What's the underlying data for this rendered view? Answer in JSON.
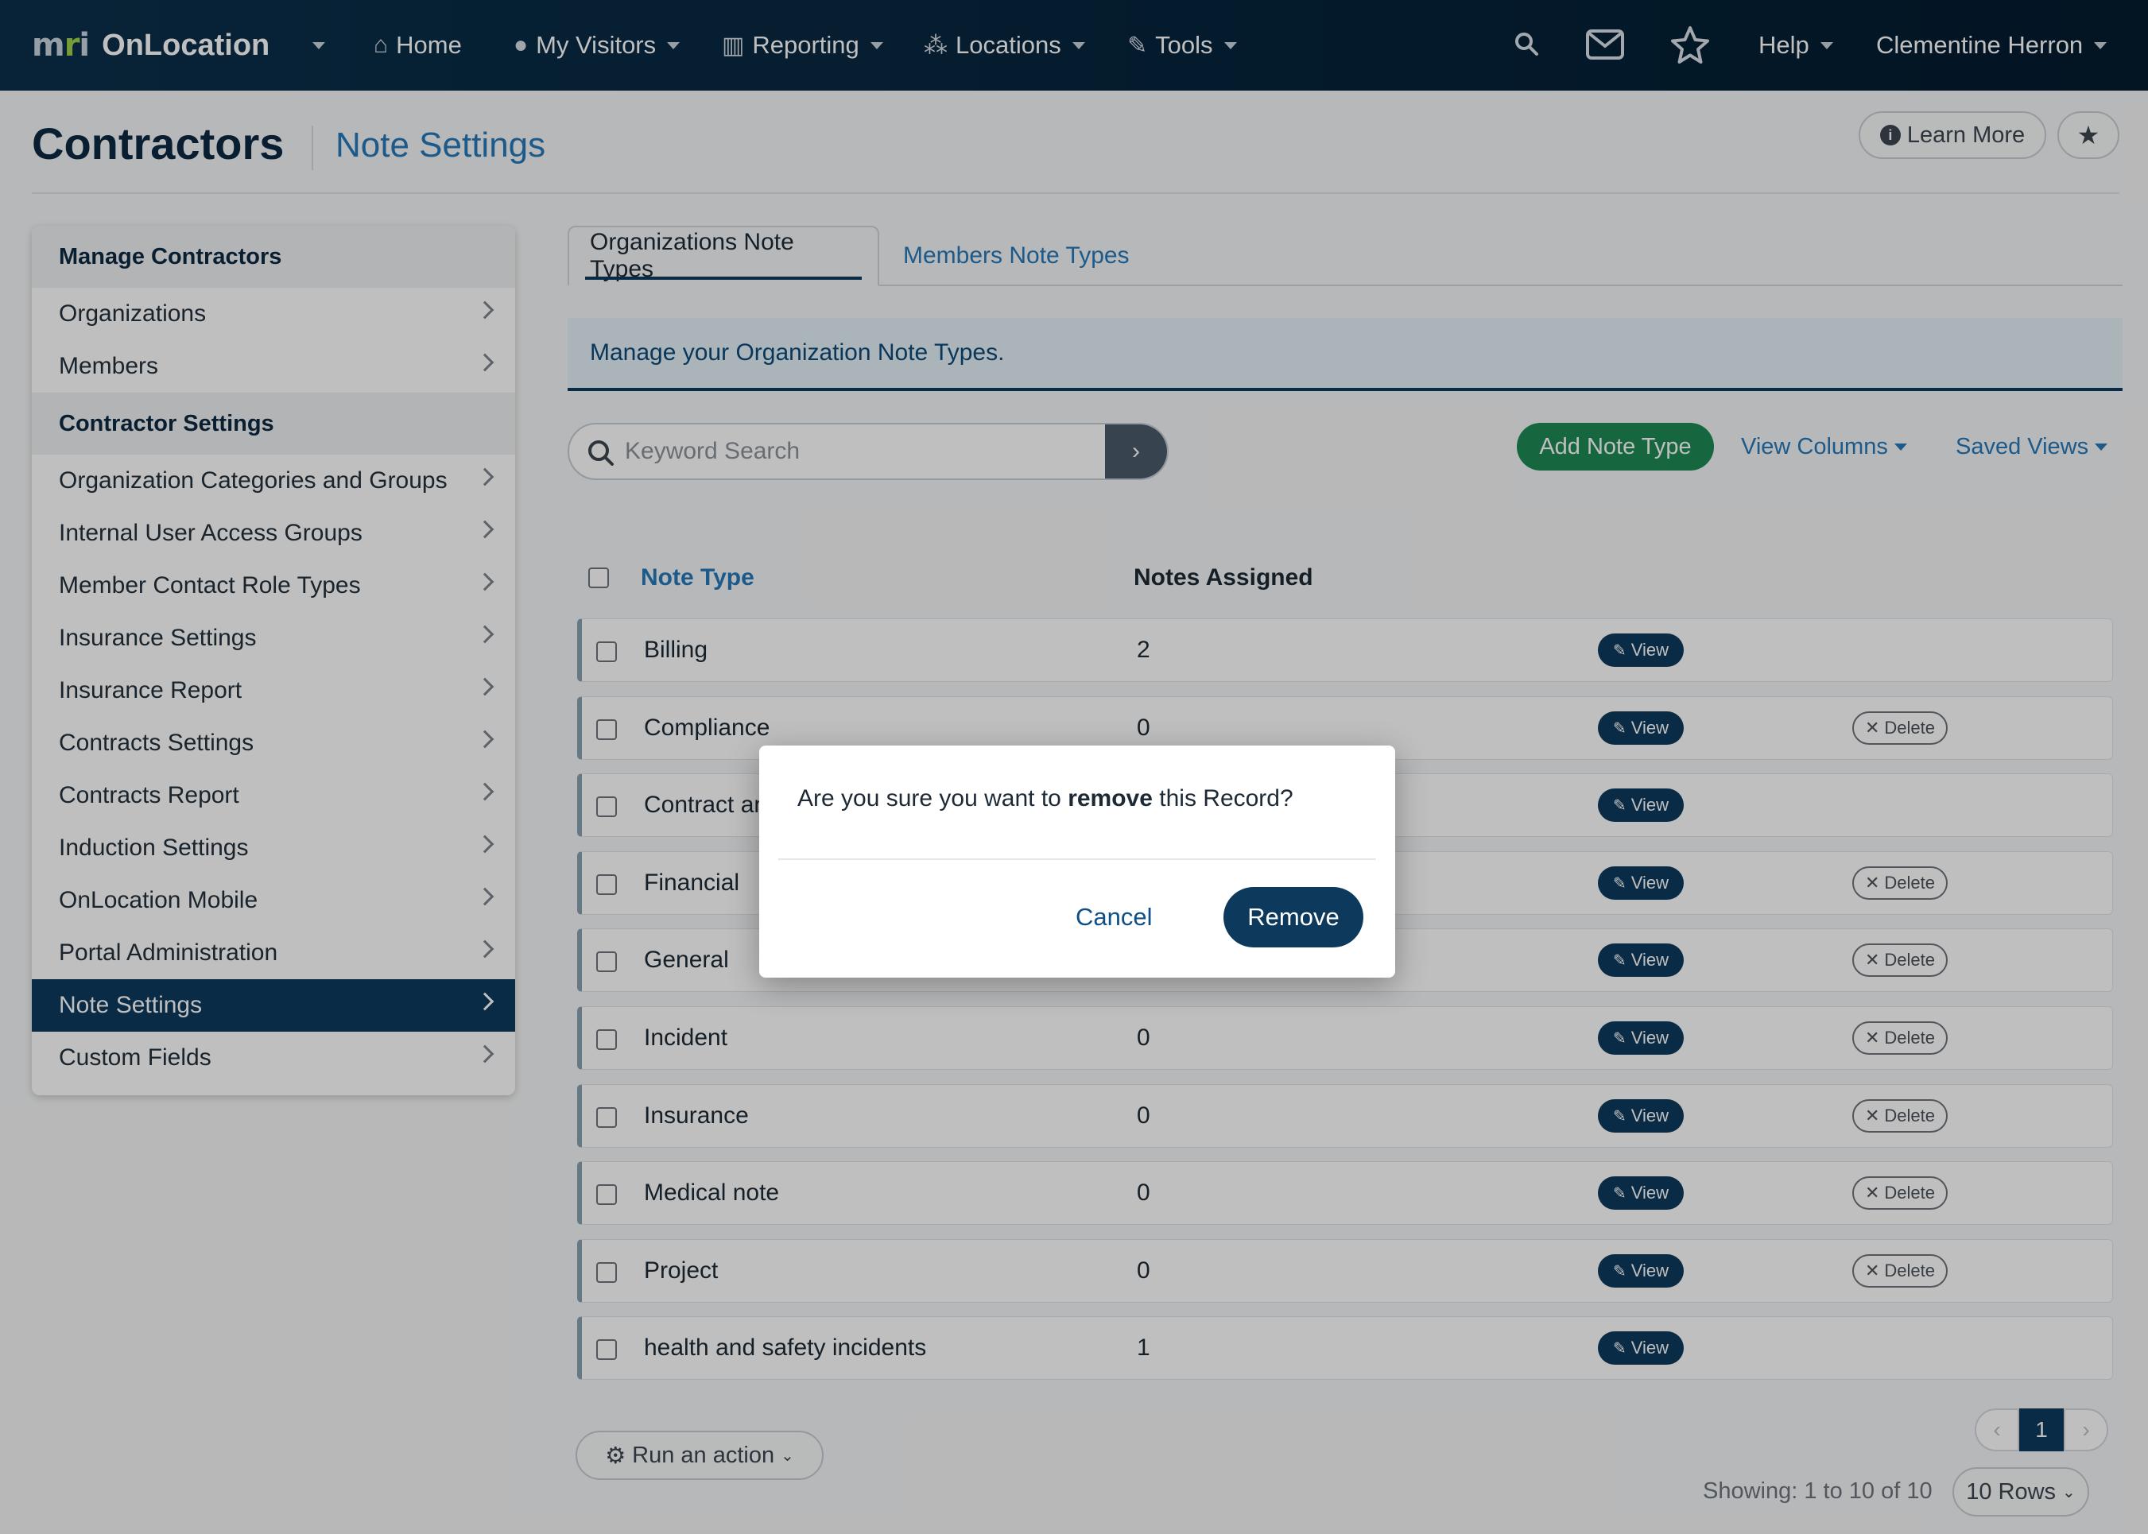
{
  "app": {
    "logo_text": "mri",
    "name": "OnLocation"
  },
  "nav": {
    "home": "Home",
    "my_visitors": "My Visitors",
    "reporting": "Reporting",
    "locations": "Locations",
    "tools": "Tools",
    "help": "Help",
    "user": "Clementine Herron"
  },
  "header": {
    "title": "Contractors",
    "subtitle": "Note Settings",
    "learn_more": "Learn More"
  },
  "sidebar": {
    "section1": "Manage Contractors",
    "section1_items": [
      {
        "label": "Organizations"
      },
      {
        "label": "Members"
      }
    ],
    "section2": "Contractor Settings",
    "section2_items": [
      {
        "label": "Organization Categories and Groups"
      },
      {
        "label": "Internal User Access Groups"
      },
      {
        "label": "Member Contact Role Types"
      },
      {
        "label": "Insurance Settings"
      },
      {
        "label": "Insurance Report"
      },
      {
        "label": "Contracts Settings"
      },
      {
        "label": "Contracts Report"
      },
      {
        "label": "Induction Settings"
      },
      {
        "label": "OnLocation Mobile"
      },
      {
        "label": "Portal Administration"
      },
      {
        "label": "Note Settings"
      },
      {
        "label": "Custom Fields"
      }
    ]
  },
  "tabs": {
    "active": "Organizations Note Types",
    "inactive": "Members Note Types"
  },
  "banner": "Manage your Organization Note Types.",
  "search": {
    "placeholder": "Keyword Search"
  },
  "actions": {
    "add": "Add Note Type",
    "view_columns": "View Columns",
    "saved_views": "Saved Views"
  },
  "table": {
    "col_note_type": "Note Type",
    "col_notes_assigned": "Notes Assigned",
    "view_label": "View",
    "delete_label": "Delete",
    "rows": [
      {
        "name": "Billing",
        "count": "2",
        "deletable": false
      },
      {
        "name": "Compliance",
        "count": "0",
        "deletable": true
      },
      {
        "name": "Contract an",
        "count": "",
        "deletable": false
      },
      {
        "name": "Financial",
        "count": "",
        "deletable": true
      },
      {
        "name": "General",
        "count": "",
        "deletable": true
      },
      {
        "name": "Incident",
        "count": "0",
        "deletable": true
      },
      {
        "name": "Insurance",
        "count": "0",
        "deletable": true
      },
      {
        "name": "Medical note",
        "count": "0",
        "deletable": true
      },
      {
        "name": "Project",
        "count": "0",
        "deletable": true
      },
      {
        "name": "health and safety incidents",
        "count": "1",
        "deletable": false
      }
    ]
  },
  "footer": {
    "run_action": "Run an action",
    "current_page": "1",
    "showing": "Showing: 1 to 10 of 10",
    "rows_per_page": "10 Rows"
  },
  "modal": {
    "msg_before": "Are you sure you want to ",
    "msg_bold": "remove",
    "msg_after": " this Record?",
    "cancel": "Cancel",
    "remove": "Remove"
  }
}
